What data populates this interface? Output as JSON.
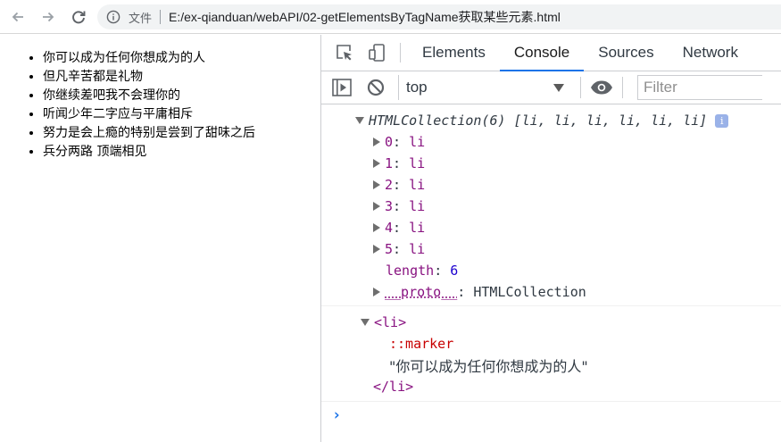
{
  "browser": {
    "back_label": "←",
    "forward_label": "→",
    "reload_label": "⟳",
    "scheme_label": "文件",
    "url": "E:/ex-qianduan/webAPI/02-getElementsByTagName获取某些元素.html"
  },
  "page": {
    "items": [
      "你可以成为任何你想成为的人",
      "但凡辛苦都是礼物",
      "你继续差吧我不会理你的",
      "听闻少年二字应与平庸相斥",
      "努力是会上瘾的特别是尝到了甜味之后",
      "兵分两路 顶端相见"
    ]
  },
  "devtools": {
    "tabs": [
      {
        "label": "Elements",
        "active": false
      },
      {
        "label": "Console",
        "active": true
      },
      {
        "label": "Sources",
        "active": false
      },
      {
        "label": "Network",
        "active": false
      }
    ],
    "toolbar": {
      "context": "top",
      "filter_placeholder": "Filter"
    },
    "console": {
      "collection_header": "HTMLCollection(6) [li, li, li, li, li, li]",
      "info_badge": "i",
      "entries": [
        {
          "index": "0",
          "value": "li"
        },
        {
          "index": "1",
          "value": "li"
        },
        {
          "index": "2",
          "value": "li"
        },
        {
          "index": "3",
          "value": "li"
        },
        {
          "index": "4",
          "value": "li"
        },
        {
          "index": "5",
          "value": "li"
        }
      ],
      "length_key": "length",
      "length_value": "6",
      "proto_key": "__proto__",
      "proto_value": "HTMLCollection",
      "element": {
        "open_tag": "<li>",
        "marker": "::marker",
        "text": "\"你可以成为任何你想成为的人\"",
        "close_tag": "</li>"
      },
      "prompt": "›"
    }
  },
  "colors": {
    "accent": "#1a73e8",
    "tag": "#881280",
    "number": "#1c00cf"
  }
}
